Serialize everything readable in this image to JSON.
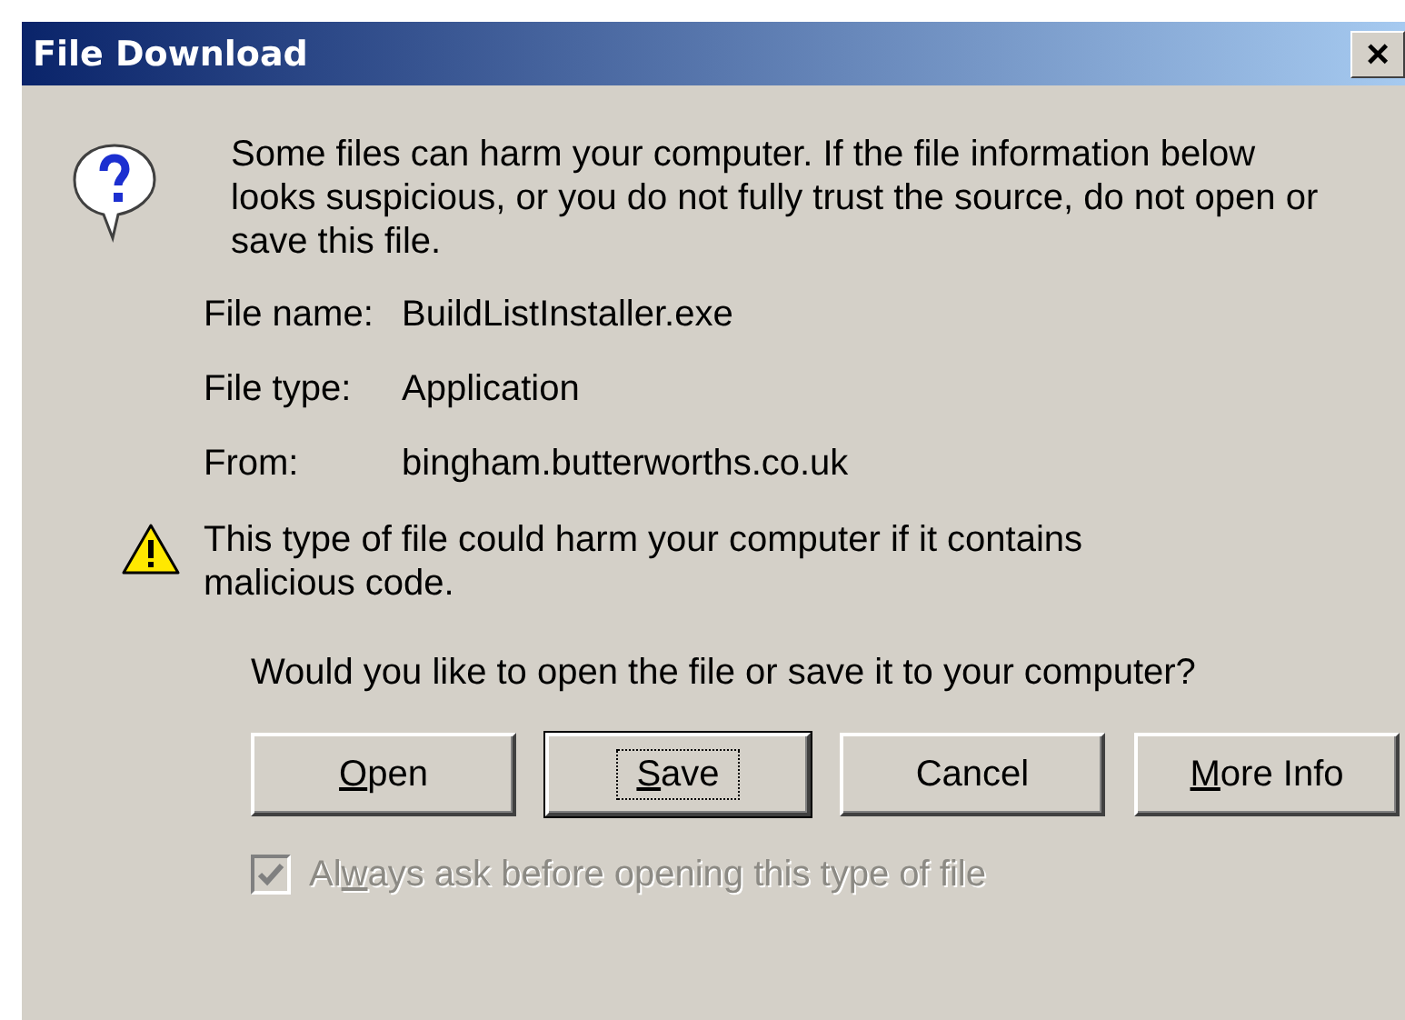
{
  "window": {
    "title": "File Download",
    "close_label": "×"
  },
  "message": "Some files can harm your computer. If the file information below looks suspicious, or you do not fully trust the source, do not open or save this file.",
  "file_info": [
    {
      "label": "File name:",
      "value": "BuildListInstaller.exe"
    },
    {
      "label": "File type:",
      "value": "Application"
    },
    {
      "label": "From:",
      "value": "bingham.butterworths.co.uk"
    }
  ],
  "warning": "This type of file could harm your computer if it contains malicious code.",
  "question": "Would you like to open the file or save it to your computer?",
  "buttons": [
    {
      "label": [
        {
          "text": "O",
          "underline": true
        },
        {
          "text": "pen",
          "underline": false
        }
      ],
      "default": false
    },
    {
      "label": [
        {
          "text": "S",
          "underline": true
        },
        {
          "text": "ave",
          "underline": false
        }
      ],
      "default": true
    },
    {
      "label": [
        {
          "text": "Cancel",
          "underline": false
        }
      ],
      "default": false
    },
    {
      "label": [
        {
          "text": "M",
          "underline": true
        },
        {
          "text": "ore Info",
          "underline": false
        }
      ],
      "default": false
    }
  ],
  "always_ask": {
    "label": [
      {
        "text": "Al",
        "underline": false
      },
      {
        "text": "w",
        "underline": true
      },
      {
        "text": "ays ask before opening this type of file",
        "underline": false
      }
    ],
    "checked": true,
    "disabled": true
  }
}
